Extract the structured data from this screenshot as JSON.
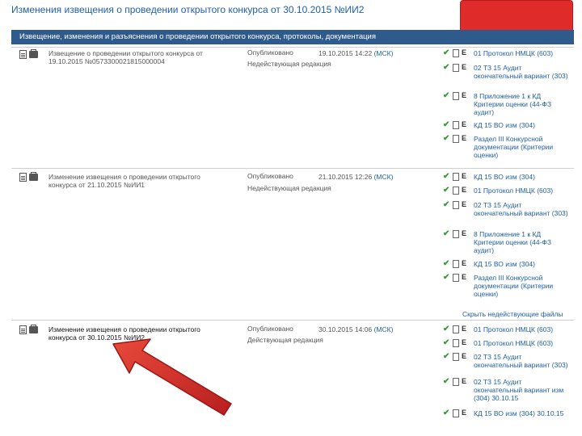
{
  "page_title": "Изменения извещения о проведении открытого конкурса от 30.10.2015 №ИИ2",
  "header": "Извещение, изменения и разъяснения о проведении открытого конкурса, протоколы, документация",
  "records": [
    {
      "title": "Извещение о проведении открытого конкурса от 19.10.2015 №0573300021815000004",
      "status": "Опубликовано",
      "edition": "Недействующая редакция",
      "date": "19.10.2015 14:22",
      "tz": "(МСК)",
      "docs": [
        "01 Протокол НМЦК (603)",
        "02 ТЗ 15 Аудит окончательный вариант (303)",
        "8 Приложение 1 к КД Критерии оценки (44-ФЗ аудит)",
        "КД 15 ВО изм (304)",
        "Раздел III Конкурсной документации (Критерии оценки)"
      ]
    },
    {
      "title": "Изменение извещения о проведении открытого конкурса от 21.10.2015 №ИИ1",
      "status": "Опубликовано",
      "edition": "Недействующая редакция",
      "date": "21.10.2015 12:26",
      "tz": "(МСК)",
      "docs": [
        "КД 15 ВО изм (304)",
        "01 Протокол НМЦК (603)",
        "02 ТЗ 15 Аудит окончательный вариант (303)",
        "8 Приложение 1 к КД Критерии оценки (44-ФЗ аудит)",
        "КД 15 ВО изм (304)",
        "Раздел III Конкурсной документации (Критерии оценки)"
      ]
    },
    {
      "title": "Изменение извещения о проведении открытого конкурса от 30.10.2015 №ИИ2",
      "status": "Опубликовано",
      "edition": "Действующая редакция",
      "date": "30.10.2015 14:06",
      "tz": "(МСК)",
      "docs": [
        "01 Протокол НМЦК (603)",
        "01 Протокол НМЦК (603)",
        "02 ТЗ 15 Аудит окончательный вариант (303)",
        "02 ТЗ 15 Аудит окончательный вариант изм (304) 30.10.15",
        "КД 15 ВО изм (304) 30.10.15"
      ]
    }
  ],
  "hide_link": "Скрыть недействующие файлы"
}
